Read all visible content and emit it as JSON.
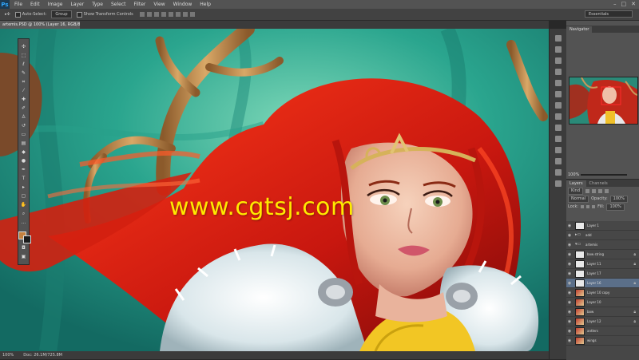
{
  "app": {
    "logo": "Ps",
    "menu": [
      "File",
      "Edit",
      "Image",
      "Layer",
      "Type",
      "Select",
      "Filter",
      "View",
      "Window",
      "Help"
    ],
    "window_controls": [
      "–",
      "□",
      "✕"
    ]
  },
  "options_bar": {
    "auto_select_label": "Auto-Select:",
    "auto_select_value": "Group",
    "show_transform_label": "Show Transform Controls",
    "workspace": "Essentials"
  },
  "document": {
    "tab_title": "artemis.PSD @ 100% (Layer 16, RGB/8) *",
    "watermark": "www.cgtsj.com"
  },
  "status_bar": {
    "zoom": "100%",
    "doc_info": "Doc: 26.1M/725.8M"
  },
  "navigator": {
    "tab_label": "Navigator",
    "zoom": "100%"
  },
  "layers_panel": {
    "tabs": [
      "Layers",
      "Channels"
    ],
    "kind_label": "Kind",
    "blend_mode": "Normal",
    "opacity_label": "Opacity:",
    "opacity_value": "100%",
    "lock_label": "Lock:",
    "fill_label": "Fill:",
    "fill_value": "100%",
    "layers": [
      {
        "name": "Layer 1",
        "type": "layer",
        "selected": false,
        "locked": false
      },
      {
        "name": "add",
        "type": "group",
        "selected": false,
        "locked": false
      },
      {
        "name": "artemis",
        "type": "group",
        "selected": false,
        "locked": false
      },
      {
        "name": "bow string",
        "type": "layer",
        "selected": false,
        "locked": true
      },
      {
        "name": "Layer 11",
        "type": "layer",
        "selected": false,
        "locked": true
      },
      {
        "name": "Layer 17",
        "type": "layer",
        "selected": false,
        "locked": false
      },
      {
        "name": "Layer 16",
        "type": "layer",
        "selected": true,
        "locked": true
      },
      {
        "name": "Layer 10 copy",
        "type": "art",
        "selected": false,
        "locked": false
      },
      {
        "name": "Layer 10",
        "type": "art",
        "selected": false,
        "locked": false
      },
      {
        "name": "bow",
        "type": "art",
        "selected": false,
        "locked": true
      },
      {
        "name": "Layer 12",
        "type": "art",
        "selected": false,
        "locked": true
      },
      {
        "name": "antlers",
        "type": "art",
        "selected": false,
        "locked": false
      },
      {
        "name": "wings",
        "type": "art",
        "selected": false,
        "locked": false
      }
    ]
  },
  "icons": {
    "visibility": "eye-icon",
    "lock": "lock-icon",
    "folder": "folder-icon"
  }
}
